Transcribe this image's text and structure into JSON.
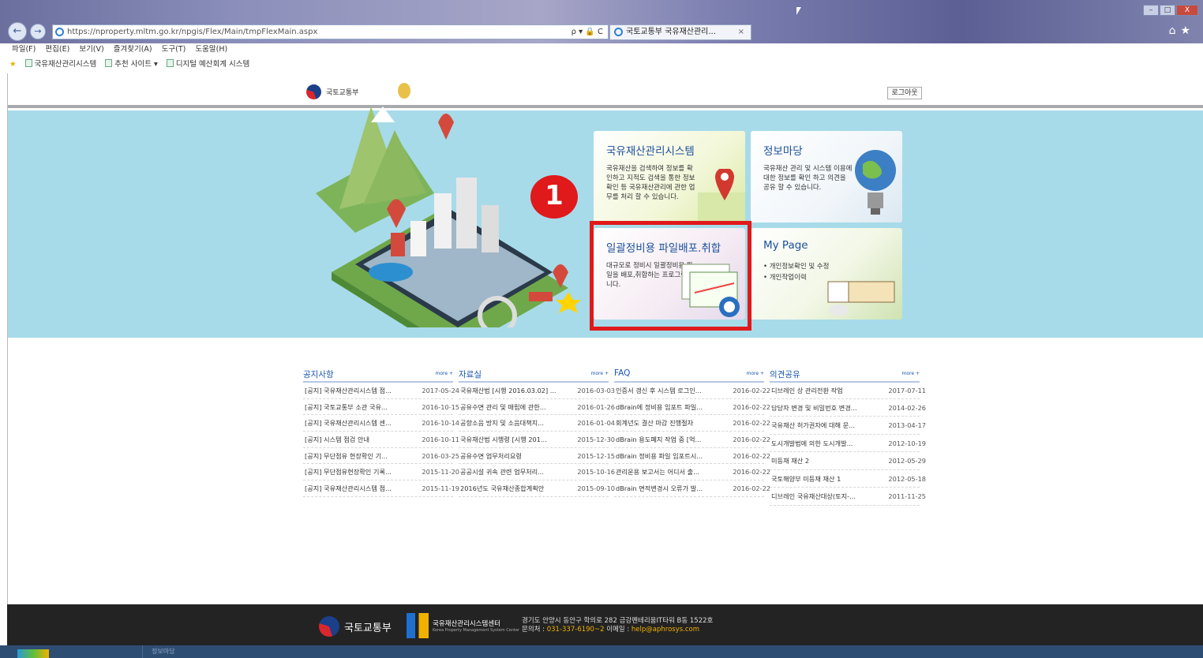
{
  "browser": {
    "url": "https://nproperty.mltm.go.kr/npgis/Flex/Main/tmpFlexMain.aspx",
    "url_controls": "ρ ▾ 🔒 C",
    "tab_title": "국토교통부 국유재산관리...",
    "tab_close": "×",
    "menu": [
      "파일(F)",
      "편집(E)",
      "보기(V)",
      "즐겨찾기(A)",
      "도구(T)",
      "도움말(H)"
    ],
    "favorites": [
      "국유재산관리시스템",
      "추천 사이트 ▾",
      "디지털 예산회계 시스템"
    ],
    "window_buttons": [
      "–",
      "□",
      "X"
    ],
    "top_icons": "⌂★"
  },
  "header": {
    "logo_text": "국토교통부",
    "logout_label": "로그아웃"
  },
  "cards": [
    {
      "title": "국유재산관리시스템",
      "desc": "국유재산을 검색하여 정보를 확인하고 지적도 검색을 통한 정보확인 등 국유재산관리에 관한 업무를 처리 할 수 있습니다."
    },
    {
      "title": "정보마당",
      "desc": "국유재산 관리 및 시스템 이용에대한 정보를 확인 하고 의견을 공유 할 수 있습니다."
    },
    {
      "title": "일괄정비용 파일배포.취합",
      "desc": "대규모로 정비시 일괄정비용 파일을 배포,취합하는 프로그램입니다."
    },
    {
      "title": "My Page",
      "items": [
        "• 개인정보확인 및 수정",
        "• 개인작업이력"
      ]
    }
  ],
  "annotation_badge": "1",
  "boards": [
    {
      "title": "공지사항",
      "more": "more +",
      "rows": [
        {
          "t": "[공지] 국유재산관리시스템 점...",
          "d": "2017-05-24"
        },
        {
          "t": "[공지] 국토교통부 소관 국유...",
          "d": "2016-10-15"
        },
        {
          "t": "[공지] 국유재산관리시스템 센...",
          "d": "2016-10-14"
        },
        {
          "t": "[공지] 시스템 점검 안내",
          "d": "2016-10-11"
        },
        {
          "t": "[공지] 무단점유 현장확인 기...",
          "d": "2016-03-25"
        },
        {
          "t": "[공지] 무단점유현장확인 기록...",
          "d": "2015-11-20"
        },
        {
          "t": "[공지] 국유재산관리시스템 점...",
          "d": "2015-11-19"
        }
      ]
    },
    {
      "title": "자료실",
      "more": "more +",
      "rows": [
        {
          "t": "국유재산법 [시행 2016.03.02] ...",
          "d": "2016-03-03"
        },
        {
          "t": "공유수면 관리 및 매립에 관한...",
          "d": "2016-01-26"
        },
        {
          "t": "공항소음 방지 및 소음대책지...",
          "d": "2016-01-04"
        },
        {
          "t": "국유재산법 시행령 [시행 201...",
          "d": "2015-12-30"
        },
        {
          "t": "공유수면 업무처리요령",
          "d": "2015-12-15"
        },
        {
          "t": "공공시설 귀속 관련 업무처리...",
          "d": "2015-10-16"
        },
        {
          "t": "2016년도 국유재산종합계획안",
          "d": "2015-09-10"
        }
      ]
    },
    {
      "title": "FAQ",
      "more": "more +",
      "rows": [
        {
          "t": "인증서 갱신 후 시스템 로그인...",
          "d": "2016-02-22"
        },
        {
          "t": "dBrain에 정비용 임포트 파일...",
          "d": "2016-02-22"
        },
        {
          "t": "회계년도 결산 마감 진행절차",
          "d": "2016-02-22"
        },
        {
          "t": "dBrain 용도폐지 작업 중 [억...",
          "d": "2016-02-22"
        },
        {
          "t": "dBrain 정비용 파일 임포트시...",
          "d": "2016-02-22"
        },
        {
          "t": "관리운용 보고서는 어디서 출...",
          "d": "2016-02-22"
        },
        {
          "t": "dBrain 면적변경시 오류가 발...",
          "d": "2016-02-22"
        }
      ]
    },
    {
      "title": "의견공유",
      "more": "more +",
      "rows": [
        {
          "t": "디브레인 상 관리전환 작업",
          "d": "2017-07-11"
        },
        {
          "t": "담당자 변경 및 비밀번호 변경...",
          "d": "2014-02-26"
        },
        {
          "t": "국유재산 허가권자에 대해 문...",
          "d": "2013-04-17"
        },
        {
          "t": "도시개발법에 의한 도시개발...",
          "d": "2012-10-19"
        },
        {
          "t": "미등재 재산 2",
          "d": "2012-05-29"
        },
        {
          "t": "국토해양부 미등재 재산 1",
          "d": "2012-05-18"
        },
        {
          "t": "디브레인 국유재산대상(토지-...",
          "d": "2011-11-25"
        }
      ]
    }
  ],
  "footer": {
    "logo_text": "국토교통부",
    "center_name": "국유재산관리시스템센터",
    "center_sub": "Korea Property Management System Center",
    "address": "경기도 안양시 동안구 학의로 282 금강펜테리움IT타워 B동 1522호",
    "contact_label": "문의처 : ",
    "phone": "031-337-6190~2",
    "email_label": "이메일 : ",
    "email": "help@aphrosys.com"
  },
  "taskbar": {
    "task_label": "정보마당"
  }
}
